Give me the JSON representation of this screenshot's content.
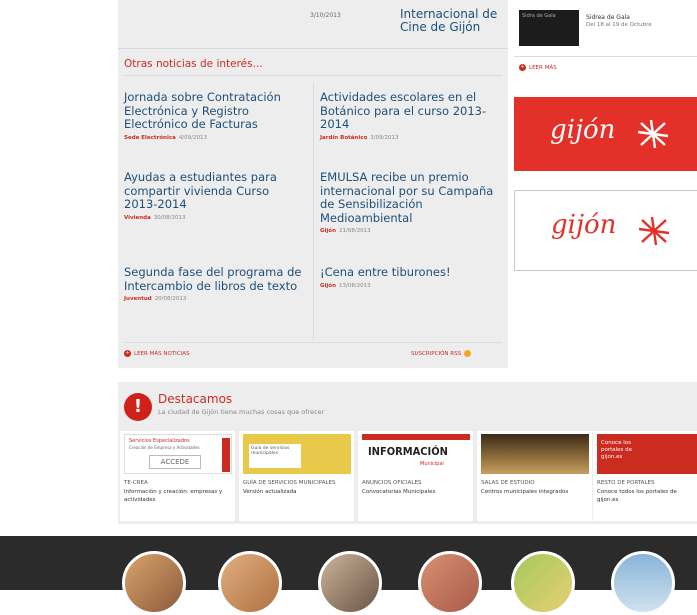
{
  "top_news": {
    "date": "3/10/2013",
    "title": "Internacional de Cine de Gijón"
  },
  "section_title": "Otras noticias de interés...",
  "news": [
    {
      "title": "Jornada sobre Contratación Electrónica y Registro Electrónico de Facturas",
      "category": "Sede Electrónica",
      "date": "4/09/2013"
    },
    {
      "title": "Actividades escolares en el Botánico para el curso 2013-2014",
      "category": "Jardín Botánico",
      "date": "3/09/2013"
    },
    {
      "title": "Ayudas a estudiantes para compartir vivienda Curso 2013-2014",
      "category": "Vivienda",
      "date": "30/08/2013"
    },
    {
      "title": "EMULSA recibe un premio internacional por su Campaña de Sensibilización Medioambiental",
      "category": "Gijón",
      "date": "21/08/2013"
    },
    {
      "title": "Segunda fase del programa de Intercambio de libros de texto",
      "category": "Juventud",
      "date": "20/08/2013"
    },
    {
      "title": "¡Cena entre tiburones!",
      "category": "Gijón",
      "date": "13/08/2013"
    }
  ],
  "links": {
    "more_news": "LEER MÁS NOTICIAS",
    "rss": "SUSCRIPCIÓN RSS"
  },
  "side_event": {
    "image_caption": "Sidra de Gala",
    "title": "Sidrea de Gala",
    "date": "Del 18 al 19 de Octubre",
    "more": "LEER MÁS"
  },
  "banners": {
    "logo_text": "gijón"
  },
  "destacamos": {
    "title": "Destacamos",
    "subtitle": "La ciudad de Gijón tiene muchas cosas que ofrecer",
    "cards": [
      {
        "thumb_title": "Servicios Especializados",
        "thumb_sub": "Creación de Empresa y Actividades",
        "thumb_button": "ACCEDE",
        "cat": "TE-CREA",
        "desc": "Información y creación: empresas y actividades"
      },
      {
        "thumb_title": "Guía de servicios municipales",
        "cat": "GUÍA DE SERVICIOS MUNICIPALES",
        "desc": "Versión actualizada"
      },
      {
        "thumb_title": "INFORMACIÓN",
        "thumb_sub": "Municipal",
        "cat": "ANUNCIOS OFICIALES",
        "desc": "Convocatorias Municipales"
      },
      {
        "cat": "SALAS DE ESTUDIO",
        "desc": "Centros municipales integrados"
      },
      {
        "thumb_title": "Conoce los portales de gijon.es",
        "cat": "RESTO DE PORTALES",
        "desc": "Conoce todos los portales de gijon.es"
      }
    ]
  },
  "colors": {
    "accent_red": "#cc2b20",
    "link_blue": "#1d4f7a",
    "panel_gray": "#ededed",
    "footer_dark": "#2b2b2b"
  }
}
